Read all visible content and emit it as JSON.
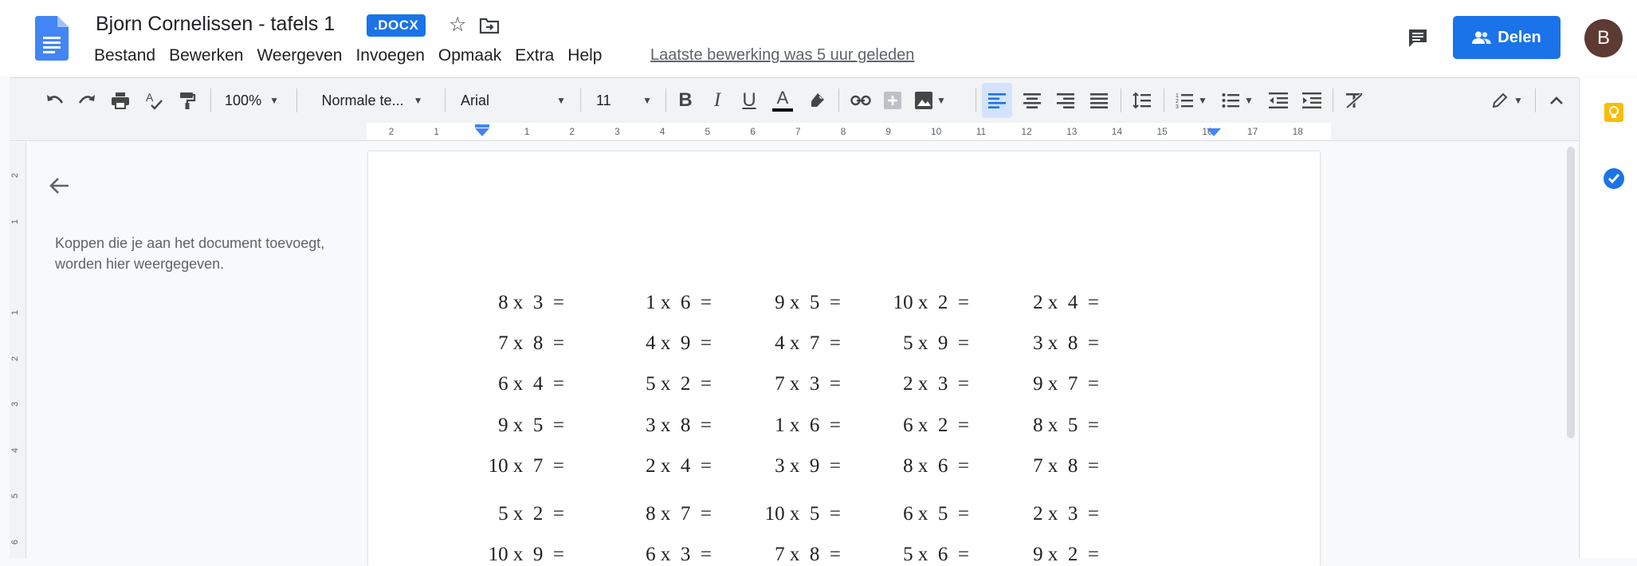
{
  "header": {
    "title": "Bjorn Cornelissen - tafels 1",
    "badge": ".DOCX",
    "last_edit": "Laatste bewerking was 5 uur geleden",
    "share_label": "Delen",
    "avatar_letter": "B"
  },
  "menu": [
    "Bestand",
    "Bewerken",
    "Weergeven",
    "Invoegen",
    "Opmaak",
    "Extra",
    "Help"
  ],
  "toolbar": {
    "zoom": "100%",
    "style": "Normale te...",
    "font": "Arial",
    "size": "11",
    "bold": "B",
    "italic": "I",
    "underline": "U",
    "text_color": "A"
  },
  "ruler": {
    "labels": [
      "2",
      "1",
      "1",
      "2",
      "3",
      "4",
      "5",
      "6",
      "7",
      "8",
      "9",
      "10",
      "11",
      "12",
      "13",
      "14",
      "15",
      "16",
      "17",
      "18"
    ]
  },
  "vruler": {
    "labels": [
      "2",
      "1",
      "1",
      "2",
      "3",
      "4",
      "5",
      "6"
    ]
  },
  "outline": {
    "empty_text": "Koppen die je aan het document toevoegt, worden hier weergegeven."
  },
  "document": {
    "rows": [
      [
        "8 x  3  =",
        "1 x  6  =",
        "9 x  5  =",
        "10 x  2  =",
        "2 x  4  ="
      ],
      [
        "7 x  8  =",
        "4 x  9  =",
        "4 x  7  =",
        "5 x  9  =",
        "3 x  8  ="
      ],
      [
        "6 x  4  =",
        "5 x  2  =",
        "7 x  3  =",
        "2 x  3  =",
        "9 x  7  ="
      ],
      [
        "9 x  5  =",
        "3 x  8  =",
        "1 x  6  =",
        "6 x  2  =",
        "8 x  5  ="
      ],
      [
        "10 x  7  =",
        "2 x  4  =",
        "3 x  9  =",
        "8 x  6  =",
        "7 x  8  ="
      ],
      [
        "5 x  2  =",
        "8 x  7  =",
        "10 x  5  =",
        "6 x  5  =",
        "2 x  3  ="
      ],
      [
        "10 x  9  =",
        "6 x  3  =",
        "7 x  8  =",
        "5 x  6  =",
        "9 x  2  ="
      ]
    ]
  },
  "colors": {
    "accent": "#1a73e8",
    "avatar": "#5d3a32",
    "keep": "#fbbc04"
  }
}
